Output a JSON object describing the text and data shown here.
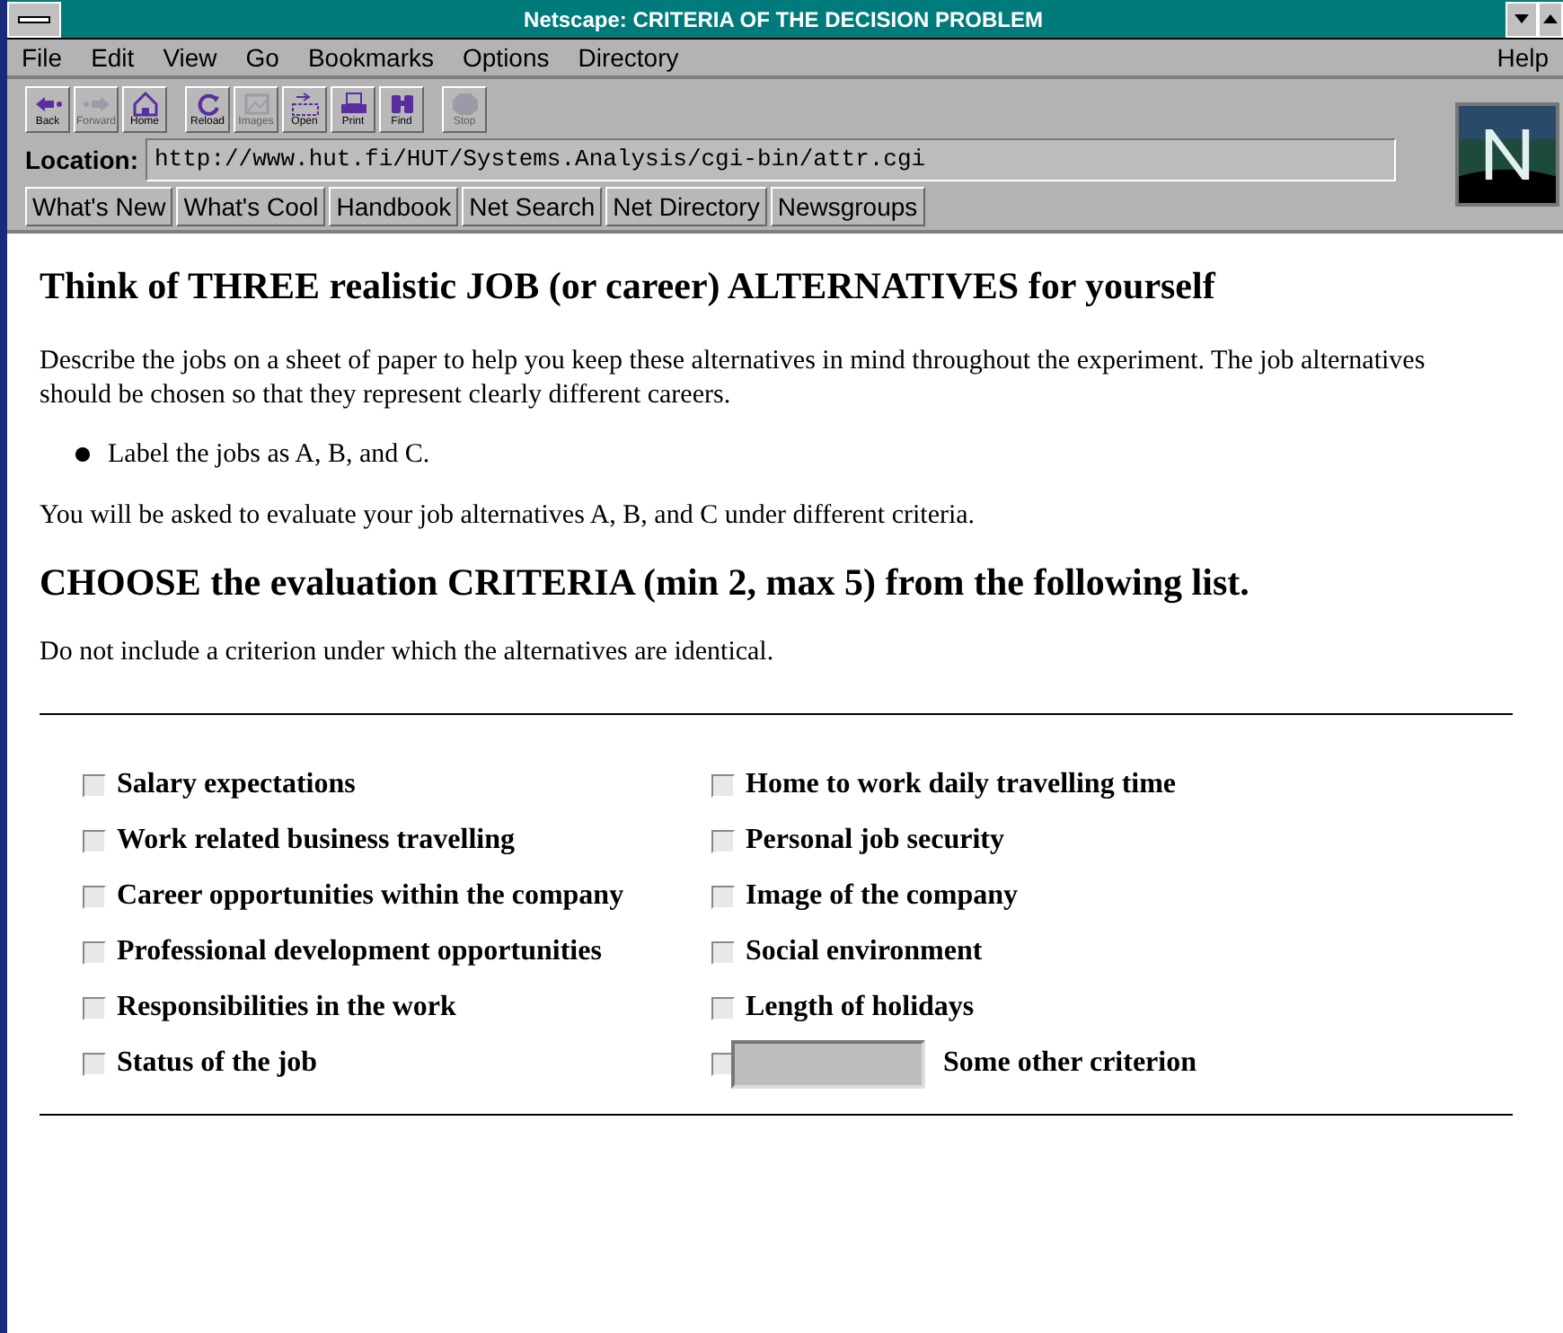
{
  "window": {
    "title": "Netscape: CRITERIA OF THE DECISION PROBLEM"
  },
  "menu": [
    "File",
    "Edit",
    "View",
    "Go",
    "Bookmarks",
    "Options",
    "Directory"
  ],
  "help_menu": "Help",
  "toolbar": [
    {
      "label": "Back",
      "kind": "back",
      "disabled": false
    },
    {
      "label": "Forward",
      "kind": "forward",
      "disabled": true
    },
    {
      "label": "Home",
      "kind": "home",
      "disabled": false
    },
    {
      "label": "Reload",
      "kind": "reload",
      "disabled": false
    },
    {
      "label": "Images",
      "kind": "images",
      "disabled": true
    },
    {
      "label": "Open",
      "kind": "open",
      "disabled": false
    },
    {
      "label": "Print",
      "kind": "print",
      "disabled": false
    },
    {
      "label": "Find",
      "kind": "find",
      "disabled": false
    },
    {
      "label": "Stop",
      "kind": "stop",
      "disabled": true
    }
  ],
  "location": {
    "label": "Location:",
    "value": "http://www.hut.fi/HUT/Systems.Analysis/cgi-bin/attr.cgi"
  },
  "directory_buttons": [
    "What's New",
    "What's Cool",
    "Handbook",
    "Net Search",
    "Net Directory",
    "Newsgroups"
  ],
  "page": {
    "heading1": "Think of THREE realistic JOB (or career) ALTERNATIVES for yourself",
    "intro": "Describe the jobs on a sheet of paper to help you keep these alternatives in mind throughout the experiment. The job alternatives should be chosen so that they represent clearly different careers.",
    "bullets": [
      "Label the jobs as A, B, and C."
    ],
    "note": "You will be asked to evaluate your job alternatives A, B, and C under different criteria.",
    "heading2": "CHOOSE the evaluation CRITERIA (min 2, max 5) from the following list.",
    "instruction": "Do not include a criterion under which the alternatives are identical.",
    "criteria_left": [
      {
        "label": "Salary expectations",
        "checked": false
      },
      {
        "label": "Work related business travelling",
        "checked": false
      },
      {
        "label": "Career opportunities within the company",
        "checked": false
      },
      {
        "label": "Professional development opportunities",
        "checked": false
      },
      {
        "label": "Responsibilities in the work",
        "checked": false
      },
      {
        "label": "Status of the job",
        "checked": false
      }
    ],
    "criteria_right": [
      {
        "label": "Home to work daily travelling time",
        "checked": false,
        "kind": "plain"
      },
      {
        "label": "Personal job security",
        "checked": false,
        "kind": "plain"
      },
      {
        "label": "Image of the company",
        "checked": false,
        "kind": "plain"
      },
      {
        "label": "Social environment",
        "checked": false,
        "kind": "plain"
      },
      {
        "label": "Length of holidays",
        "checked": false,
        "kind": "plain"
      },
      {
        "label": "Some other criterion",
        "checked": false,
        "kind": "other"
      }
    ]
  }
}
